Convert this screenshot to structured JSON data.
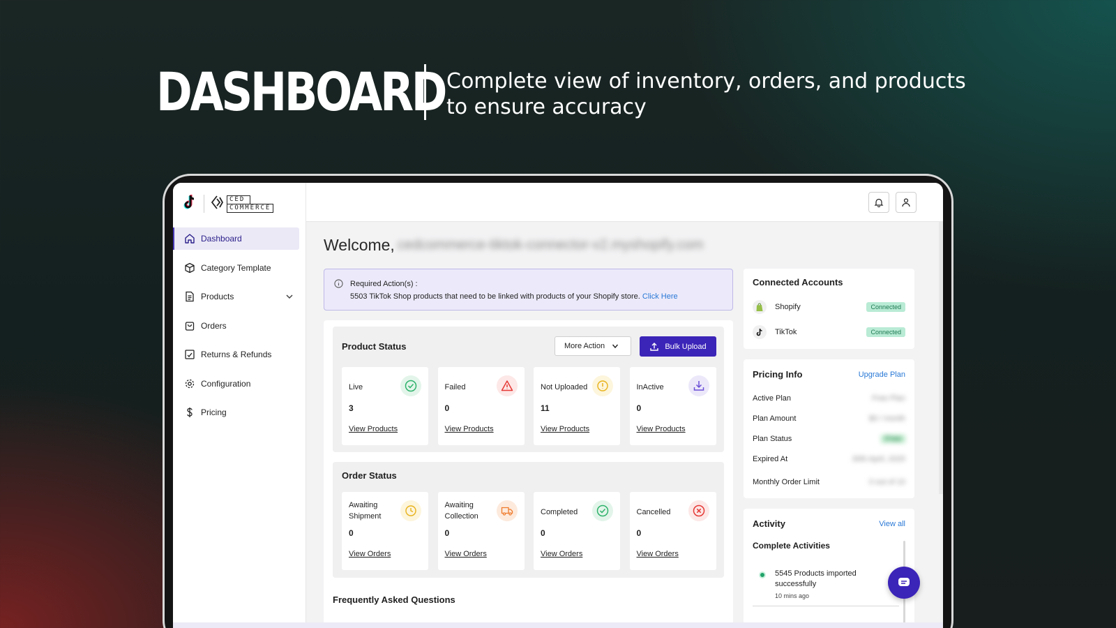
{
  "hero": {
    "title": "DASHBOARD",
    "subtitle": "Complete view of inventory, orders, and products to ensure accuracy"
  },
  "brand": {
    "logo_line1": "CED",
    "logo_line2": "COMMERCE",
    "accent_color": "#3b24b8"
  },
  "sidebar": {
    "items": [
      {
        "label": "Dashboard",
        "icon": "home-icon",
        "active": true
      },
      {
        "label": "Category Template",
        "icon": "cube-icon"
      },
      {
        "label": "Products",
        "icon": "document-icon"
      },
      {
        "label": "Orders",
        "icon": "bag-icon"
      },
      {
        "label": "Returns & Refunds",
        "icon": "return-icon"
      },
      {
        "label": "Configuration",
        "icon": "gear-icon"
      },
      {
        "label": "Pricing",
        "icon": "dollar-icon"
      }
    ]
  },
  "main": {
    "welcome_label": "Welcome,",
    "welcome_store": "cedcommerce-tiktok-connector-v2.myshopify.com",
    "alert": {
      "title": "Required Action(s) :",
      "text": "5503 TikTok Shop products that need to be linked with products of your Shopify store.",
      "link": "Click Here"
    },
    "product_status": {
      "title": "Product Status",
      "more_action": "More Action",
      "bulk_upload": "Bulk Upload",
      "cards": [
        {
          "label": "Live",
          "count": "3",
          "link": "View Products",
          "icon": "check-circle-icon",
          "color": "#2fb26b"
        },
        {
          "label": "Failed",
          "count": "0",
          "link": "View Products",
          "icon": "warning-icon",
          "color": "#e53935"
        },
        {
          "label": "Not Uploaded",
          "count": "11",
          "link": "View Products",
          "icon": "info-circle-icon",
          "color": "#e8b21a"
        },
        {
          "label": "InActive",
          "count": "0",
          "link": "View Products",
          "icon": "download-icon",
          "color": "#6b4fd6"
        }
      ]
    },
    "order_status": {
      "title": "Order Status",
      "cards": [
        {
          "label": "Awaiting Shipment",
          "count": "0",
          "link": "View Orders",
          "icon": "clock-icon",
          "color": "#e8b21a"
        },
        {
          "label": "Awaiting Collection",
          "count": "0",
          "link": "View Orders",
          "icon": "truck-icon",
          "color": "#ef7b2c"
        },
        {
          "label": "Completed",
          "count": "0",
          "link": "View Orders",
          "icon": "check-circle-icon",
          "color": "#2fb26b"
        },
        {
          "label": "Cancelled",
          "count": "0",
          "link": "View Orders",
          "icon": "x-circle-icon",
          "color": "#e53935"
        }
      ]
    },
    "faq_title": "Frequently Asked Questions"
  },
  "right": {
    "connected": {
      "title": "Connected Accounts",
      "accounts": [
        {
          "name": "Shopify",
          "status": "Connected",
          "icon": "shopify-icon"
        },
        {
          "name": "TikTok",
          "status": "Connected",
          "icon": "tiktok-icon"
        }
      ]
    },
    "pricing": {
      "title": "Pricing Info",
      "upgrade": "Upgrade Plan",
      "rows": [
        {
          "label": "Active Plan",
          "value": "Free Plan"
        },
        {
          "label": "Plan Amount",
          "value": "$0 / month"
        },
        {
          "label": "Plan Status",
          "value": "Free"
        },
        {
          "label": "Expired At",
          "value": "30th April, 2025"
        },
        {
          "label": "Monthly Order Limit",
          "value": "0 out of 10"
        }
      ]
    },
    "activity": {
      "title": "Activity",
      "view_all": "View all",
      "subtitle": "Complete Activities",
      "item_text": "5545 Products imported successfully",
      "item_time": "10 mins ago"
    }
  }
}
